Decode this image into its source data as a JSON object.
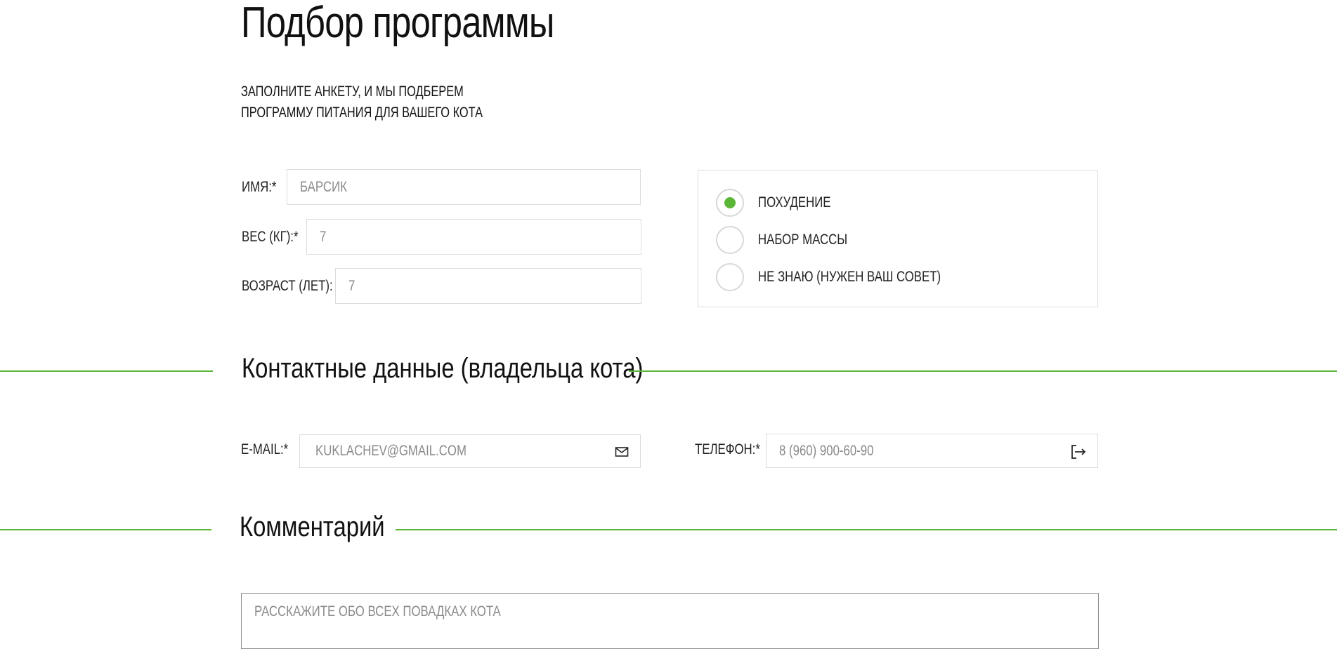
{
  "header": {
    "title": "Подбор программы",
    "subtitle_line1": "ЗАПОЛНИТЕ АНКЕТУ, И МЫ ПОДБЕРЕМ",
    "subtitle_line2": "ПРОГРАММУ ПИТАНИЯ ДЛЯ ВАШЕГО КОТА"
  },
  "cat": {
    "name_label": "ИМЯ:*",
    "name_placeholder": "БАРСИК",
    "weight_label": "ВЕС (КГ):*",
    "weight_value": "7",
    "age_label": "ВОЗРАСТ (ЛЕТ):",
    "age_value": "7"
  },
  "goal": {
    "options": [
      {
        "label": "ПОХУДЕНИЕ",
        "selected": true
      },
      {
        "label": "НАБОР МАССЫ",
        "selected": false
      },
      {
        "label": "НЕ ЗНАЮ (НУЖЕН ВАШ СОВЕТ)",
        "selected": false
      }
    ]
  },
  "contacts": {
    "section_title": "Контактные данные (владельца кота)",
    "email_label": "E-MAIL:*",
    "email_placeholder": "KUKLACHEV@GMAIL.COM",
    "email_icon": "envelope-icon",
    "phone_label": "ТЕЛЕФОН:*",
    "phone_placeholder": "8 (960) 900-60-90",
    "phone_icon": "phone-login-icon"
  },
  "comment": {
    "section_title": "Комментарий",
    "placeholder": "РАССКАЖИТЕ ОБО ВСЕХ ПОВАДКАХ КОТА"
  },
  "colors": {
    "accent": "#5bb638",
    "border": "#dcdcdc",
    "placeholder": "#8a8a8a"
  }
}
